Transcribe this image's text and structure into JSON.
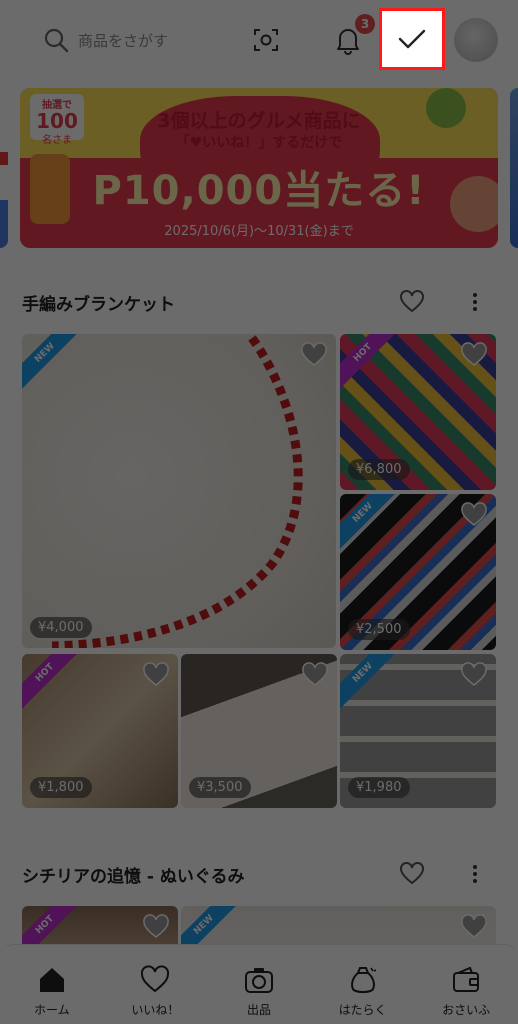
{
  "header": {
    "search_placeholder": "商品をさがす",
    "notification_count": "3",
    "icons": [
      "search-icon",
      "barcode-scan-icon",
      "bell-icon",
      "checkmark-icon",
      "avatar"
    ]
  },
  "banner": {
    "badge_small": "抽選で",
    "badge_number": "100",
    "badge_unit": "名さま",
    "headline": "3個以上のグルメ商品に",
    "subline": "「♥いいね！」するだけで",
    "big_text": "P10,000当たる!",
    "dates": "2025/10/6(月)〜10/31(金)まで"
  },
  "sections": [
    {
      "title": "手編みブランケット",
      "items": [
        {
          "price": "¥4,000",
          "tag": "NEW"
        },
        {
          "price": "¥6,800",
          "tag": "HOT"
        },
        {
          "price": "¥2,500",
          "tag": "NEW"
        },
        {
          "price": "¥1,800",
          "tag": "HOT"
        },
        {
          "price": "¥3,500",
          "tag": ""
        },
        {
          "price": "¥1,980",
          "tag": "NEW"
        }
      ]
    },
    {
      "title": "シチリアの追憶 - ぬいぐるみ",
      "items": [
        {
          "price": "",
          "tag": "HOT"
        },
        {
          "price": "",
          "tag": "NEW"
        }
      ]
    }
  ],
  "bottom_nav": [
    {
      "label": "ホーム",
      "icon": "home-icon"
    },
    {
      "label": "いいね！",
      "icon": "heart-icon"
    },
    {
      "label": "出品",
      "icon": "camera-icon"
    },
    {
      "label": "はたらく",
      "icon": "money-bag-icon"
    },
    {
      "label": "おさいふ",
      "icon": "wallet-icon"
    }
  ],
  "colors": {
    "badge_red": "#e84c4c",
    "highlight_red": "#ff1a1a",
    "new_ribbon": "#1e9be8",
    "hot_ribbon": "#c22fd0"
  }
}
